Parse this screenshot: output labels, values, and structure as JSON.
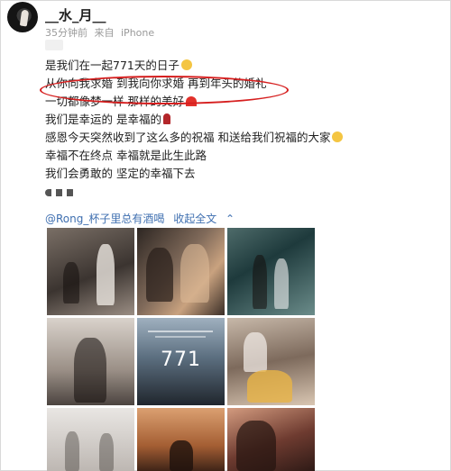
{
  "header": {
    "username": "__水_月__",
    "time": "35分钟前",
    "source_prefix": "来自",
    "source": "iPhone"
  },
  "post": {
    "lines": [
      "是我们在一起771天的日子",
      "从你向我求婚 到我向你求婚 再到年头的婚礼",
      "一切都像梦一样 那样的美好",
      "我们是幸运的 是幸福的",
      "感恩今天突然收到了这么多的祝福 和送给我们祝福的大家",
      "幸福不在终点 幸福就是此生此路",
      "我们会勇敢的 坚定的幸福下去"
    ],
    "tail_emoji": "emoji-row"
  },
  "footer": {
    "mention": "@Rong_杯子里总有酒喝",
    "collapse": "收起全文",
    "collapse_icon": "chevron-up-icon"
  },
  "photos": {
    "count": 9,
    "tile5_number": "771"
  },
  "colors": {
    "link": "#3f6fb0",
    "highlight": "#d61f1f",
    "meta": "#9a9a9a"
  }
}
